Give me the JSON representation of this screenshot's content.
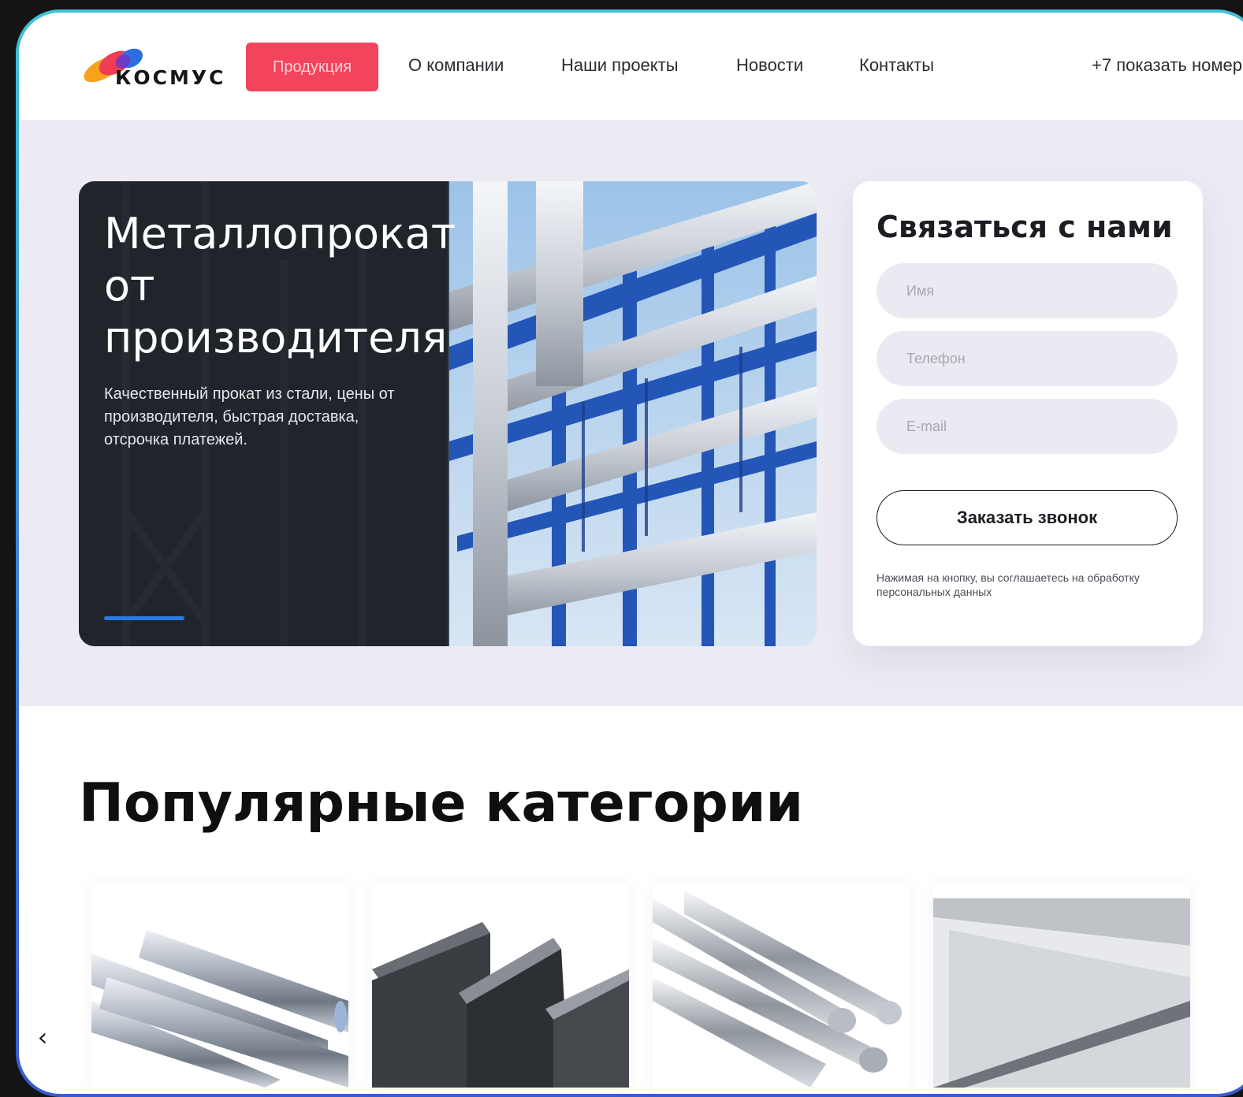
{
  "header": {
    "logo_text": "КОСМУС",
    "nav": {
      "products": "Продукция",
      "about": "О компании",
      "projects": "Наши проекты",
      "news": "Новости",
      "contacts": "Контакты"
    },
    "phone": "+7 показать номер"
  },
  "hero": {
    "title": "Металлопрокат от производителя",
    "subtitle": "Качественный прокат из стали, цены от производителя, быстрая доставка, отсрочка платежей."
  },
  "contact_form": {
    "title": "Связаться с нами",
    "name_placeholder": "Имя",
    "phone_placeholder": "Телефон",
    "email_placeholder": "E-mail",
    "submit_label": "Заказать звонок",
    "consent_note": "Нажимая на кнопку, вы соглашаетесь на обработку персональных данных"
  },
  "categories": {
    "title": "Популярные категории",
    "prev_arrow": "‹"
  },
  "colors": {
    "accent": "#f2445c",
    "hero_bg": "#eceaf3",
    "banner_bar": "#2a7be4"
  }
}
